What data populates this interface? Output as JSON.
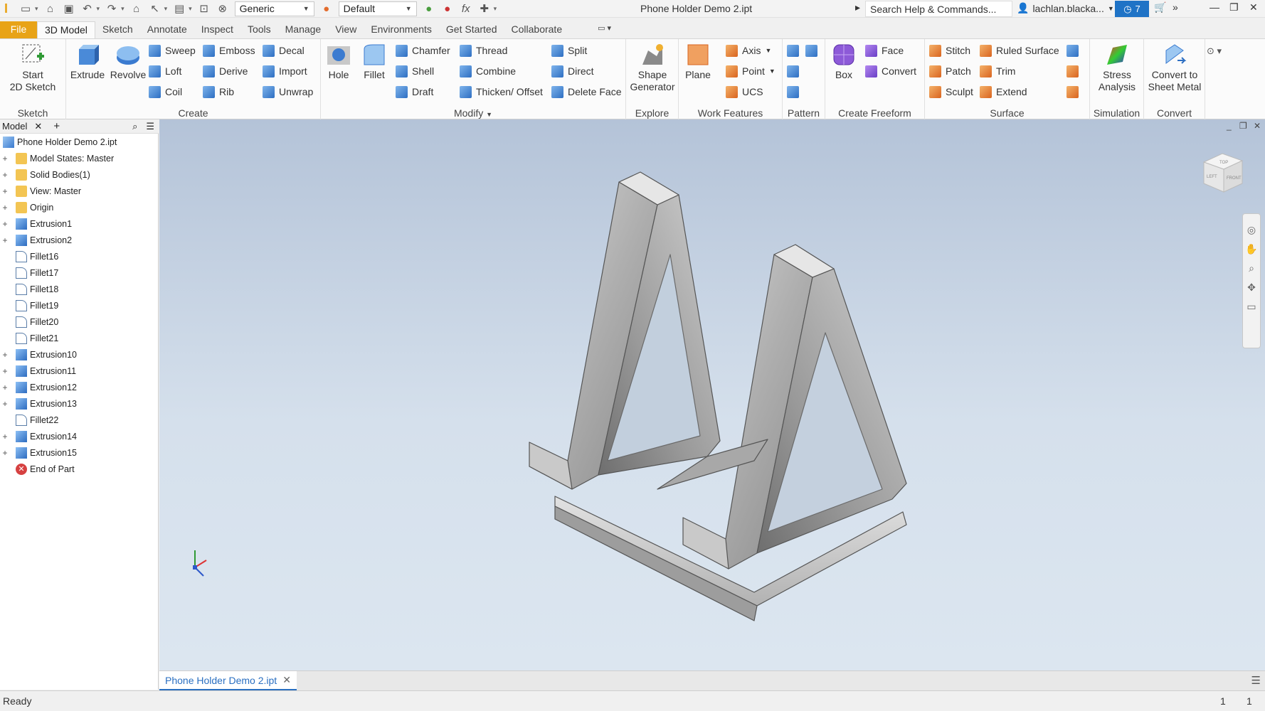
{
  "app": {
    "doc_title": "Phone Holder Demo 2.ipt",
    "quick_access": {
      "style_select": "Generic",
      "appearance_select": "Default"
    },
    "search_placeholder": "Search Help & Commands...",
    "user": "lachlan.blacka...",
    "notifications": "7"
  },
  "tabs": [
    "File",
    "3D Model",
    "Sketch",
    "Annotate",
    "Inspect",
    "Tools",
    "Manage",
    "View",
    "Environments",
    "Get Started",
    "Collaborate"
  ],
  "ribbon": {
    "sketch": {
      "label": "Sketch",
      "start": "Start\n2D Sketch"
    },
    "create": {
      "label": "Create",
      "extrude": "Extrude",
      "revolve": "Revolve",
      "sweep": "Sweep",
      "loft": "Loft",
      "coil": "Coil",
      "emboss": "Emboss",
      "derive": "Derive",
      "rib": "Rib",
      "decal": "Decal",
      "import": "Import",
      "unwrap": "Unwrap"
    },
    "modify": {
      "label": "Modify",
      "hole": "Hole",
      "fillet": "Fillet",
      "chamfer": "Chamfer",
      "shell": "Shell",
      "draft": "Draft",
      "thread": "Thread",
      "combine": "Combine",
      "thicken": "Thicken/ Offset",
      "split": "Split",
      "direct": "Direct",
      "delete_face": "Delete Face"
    },
    "explore": {
      "label": "Explore",
      "shape_generator": "Shape\nGenerator"
    },
    "work_features": {
      "label": "Work Features",
      "plane": "Plane",
      "axis": "Axis",
      "point": "Point",
      "ucs": "UCS"
    },
    "pattern": {
      "label": "Pattern"
    },
    "freeform": {
      "label": "Create Freeform",
      "box": "Box",
      "face": "Face",
      "convert": "Convert"
    },
    "surface": {
      "label": "Surface",
      "stitch": "Stitch",
      "patch": "Patch",
      "sculpt": "Sculpt",
      "ruled_surface": "Ruled Surface",
      "trim": "Trim",
      "extend": "Extend"
    },
    "simulation": {
      "label": "Simulation",
      "stress": "Stress\nAnalysis"
    },
    "convert": {
      "label": "Convert",
      "sheet_metal": "Convert to\nSheet Metal"
    }
  },
  "browser": {
    "tab_label": "Model",
    "nodes": [
      {
        "label": "Phone Holder Demo 2.ipt",
        "icon": "part",
        "expand": ""
      },
      {
        "label": "Model States: Master",
        "icon": "folder",
        "expand": "+"
      },
      {
        "label": "Solid Bodies(1)",
        "icon": "folder",
        "expand": "+"
      },
      {
        "label": "View: Master",
        "icon": "folder",
        "expand": "+"
      },
      {
        "label": "Origin",
        "icon": "folder",
        "expand": "+"
      },
      {
        "label": "Extrusion1",
        "icon": "feature",
        "expand": "+"
      },
      {
        "label": "Extrusion2",
        "icon": "feature",
        "expand": "+"
      },
      {
        "label": "Fillet16",
        "icon": "fillet",
        "expand": ""
      },
      {
        "label": "Fillet17",
        "icon": "fillet",
        "expand": ""
      },
      {
        "label": "Fillet18",
        "icon": "fillet",
        "expand": ""
      },
      {
        "label": "Fillet19",
        "icon": "fillet",
        "expand": ""
      },
      {
        "label": "Fillet20",
        "icon": "fillet",
        "expand": ""
      },
      {
        "label": "Fillet21",
        "icon": "fillet",
        "expand": ""
      },
      {
        "label": "Extrusion10",
        "icon": "feature",
        "expand": "+"
      },
      {
        "label": "Extrusion11",
        "icon": "feature",
        "expand": "+"
      },
      {
        "label": "Extrusion12",
        "icon": "feature",
        "expand": "+"
      },
      {
        "label": "Extrusion13",
        "icon": "feature",
        "expand": "+"
      },
      {
        "label": "Fillet22",
        "icon": "fillet",
        "expand": ""
      },
      {
        "label": "Extrusion14",
        "icon": "feature",
        "expand": "+"
      },
      {
        "label": "Extrusion15",
        "icon": "feature",
        "expand": "+"
      },
      {
        "label": "End of Part",
        "icon": "end",
        "expand": ""
      }
    ]
  },
  "doc_tab": "Phone Holder Demo 2.ipt",
  "status": {
    "text": "Ready",
    "count_a": "1",
    "count_b": "1"
  },
  "viewcube": {
    "top": "TOP",
    "left": "LEFT",
    "front": "FRONT"
  }
}
